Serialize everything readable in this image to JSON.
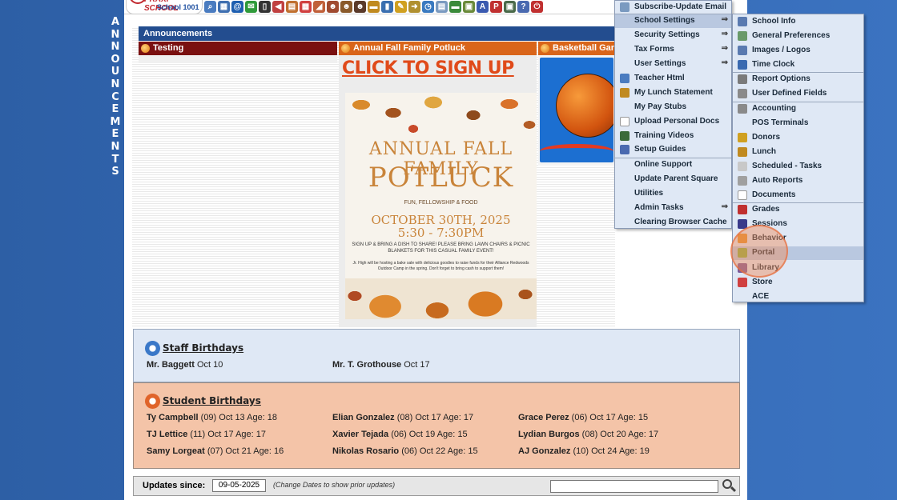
{
  "side_letters": [
    "A",
    "N",
    "N",
    "O",
    "U",
    "N",
    "C",
    "E",
    "M",
    "E",
    "N",
    "T",
    "S"
  ],
  "logo": {
    "brand": "PRAXI SCHOOL",
    "school": "School 1001"
  },
  "toolbar_icons": [
    {
      "name": "search-icon",
      "color": "#4a7cc0",
      "glyph": "⌕"
    },
    {
      "name": "calendar-grid-icon",
      "color": "#3f6fb0",
      "glyph": "▦"
    },
    {
      "name": "email-icon",
      "color": "#1f5fb0",
      "glyph": "@"
    },
    {
      "name": "chat-icon",
      "color": "#2f9a3a",
      "glyph": "✉"
    },
    {
      "name": "phone-icon",
      "color": "#333333",
      "glyph": "▯"
    },
    {
      "name": "megaphone-icon",
      "color": "#c04040",
      "glyph": "◀"
    },
    {
      "name": "report-icon",
      "color": "#c07030",
      "glyph": "▤"
    },
    {
      "name": "calendar-icon",
      "color": "#d04040",
      "glyph": "▦"
    },
    {
      "name": "announcement-icon",
      "color": "#c0603a",
      "glyph": "◢"
    },
    {
      "name": "user-icon",
      "color": "#a04a30",
      "glyph": "☻"
    },
    {
      "name": "teacher-icon",
      "color": "#8a5a2a",
      "glyph": "☻"
    },
    {
      "name": "group-icon",
      "color": "#5a3a2a",
      "glyph": "☻"
    },
    {
      "name": "ticket-icon",
      "color": "#c08a20",
      "glyph": "▬"
    },
    {
      "name": "book-icon",
      "color": "#3a6fb0",
      "glyph": "▮"
    },
    {
      "name": "pencil-icon",
      "color": "#d0a020",
      "glyph": "✎"
    },
    {
      "name": "forward-icon",
      "color": "#b09030",
      "glyph": "➜"
    },
    {
      "name": "clock-icon",
      "color": "#3a7ac0",
      "glyph": "◷"
    },
    {
      "name": "sheet-icon",
      "color": "#7a9ac0",
      "glyph": "▤"
    },
    {
      "name": "money-icon",
      "color": "#3a8a3a",
      "glyph": "▬"
    },
    {
      "name": "printer-icon",
      "color": "#6a8a3a",
      "glyph": "▣"
    },
    {
      "name": "api-icon",
      "color": "#3a5ab0",
      "glyph": "A"
    },
    {
      "name": "pdf-icon",
      "color": "#c03030",
      "glyph": "P"
    },
    {
      "name": "cash-icon",
      "color": "#4a6a4a",
      "glyph": "▣"
    },
    {
      "name": "help-icon",
      "color": "#4a6ab0",
      "glyph": "?"
    },
    {
      "name": "power-icon",
      "color": "#c03030",
      "glyph": "⏻"
    }
  ],
  "announcements": {
    "header": "Announcements",
    "columns": [
      {
        "title": "Testing"
      },
      {
        "title": "Annual Fall Family Potluck",
        "link": "CLICK TO SIGN UP"
      },
      {
        "title": "Basketball Game"
      }
    ],
    "flyer": {
      "title1": "ANNUAL FALL FAMILY",
      "title2": "POTLUCK",
      "tagline": "FUN, FELLOWSHIP & FOOD",
      "date1": "OCTOBER 30TH, 2025",
      "date2": "5:30 - 7:30PM",
      "note1": "SIGN UP & BRING A DISH TO SHARE! PLEASE BRING LAWN CHAIRS & PICNIC BLANKETS FOR THIS CASUAL FAMILY EVENT!",
      "note2": "Jr. High will be hosting a bake sale with delicious goodies to raise funds for their Alliance Redwoods Outdoor Camp in the spring. Don't forget to bring cash to support them!"
    }
  },
  "staff_birthdays": {
    "title": "Staff Birthdays",
    "entries": [
      {
        "name": "Mr. Baggett",
        "detail": "Oct 10"
      },
      {
        "name": "Mr. T. Grothouse",
        "detail": "Oct 17"
      }
    ]
  },
  "student_birthdays": {
    "title": "Student Birthdays",
    "entries": [
      {
        "name": "Ty Campbell",
        "detail": "(09) Oct 13 Age: 18"
      },
      {
        "name": "Elian Gonzalez",
        "detail": "(08) Oct 17 Age: 17"
      },
      {
        "name": "Grace Perez",
        "detail": "(06) Oct 17 Age: 15"
      },
      {
        "name": "TJ Lettice",
        "detail": "(11) Oct 17 Age: 17"
      },
      {
        "name": "Xavier Tejada",
        "detail": "(06) Oct 19 Age: 15"
      },
      {
        "name": "Lydian Burgos",
        "detail": "(08) Oct 20 Age: 17"
      },
      {
        "name": "Samy Lorgeat",
        "detail": "(07) Oct 21 Age: 16"
      },
      {
        "name": "Nikolas Rosario",
        "detail": "(06) Oct 22 Age: 15"
      },
      {
        "name": "AJ Gonzalez",
        "detail": "(10) Oct 24 Age: 19"
      }
    ]
  },
  "updates": {
    "label": "Updates since:",
    "date": "09-05-2025",
    "hint": "(Change Dates to show prior updates)",
    "search_value": ""
  },
  "menu1": {
    "items": [
      {
        "label": "Subscribe-Update Email",
        "icon": "email-icon",
        "icon_color": "#7a9ac0",
        "arrow": ""
      },
      {
        "label": "School Settings",
        "icon": "",
        "icon_color": "",
        "arrow": "⇒",
        "active": true
      },
      {
        "label": "Security Settings",
        "icon": "",
        "icon_color": "",
        "arrow": "⇒"
      },
      {
        "label": "Tax Forms",
        "icon": "",
        "icon_color": "",
        "arrow": "⇒"
      },
      {
        "label": "User Settings",
        "icon": "",
        "icon_color": "",
        "arrow": "⇒"
      },
      {
        "label": "Teacher Html",
        "icon": "html-icon",
        "icon_color": "#4a7cc0",
        "arrow": ""
      },
      {
        "label": "My Lunch Statement",
        "icon": "lunch-icon",
        "icon_color": "#c08a20",
        "arrow": ""
      },
      {
        "label": "My Pay Stubs",
        "icon": "",
        "icon_color": "",
        "arrow": ""
      },
      {
        "label": "Upload Personal Docs",
        "icon": "document-icon",
        "icon_color": "#ffffff",
        "arrow": ""
      },
      {
        "label": "Training Videos",
        "icon": "film-icon",
        "icon_color": "#3a6a3a",
        "arrow": ""
      },
      {
        "label": "Setup Guides",
        "icon": "help-icon",
        "icon_color": "#4a6ab0",
        "arrow": ""
      },
      {
        "label": "Online Support",
        "icon": "",
        "icon_color": "",
        "arrow": ""
      },
      {
        "label": "Update Parent Square",
        "icon": "",
        "icon_color": "",
        "arrow": ""
      },
      {
        "label": "Utilities",
        "icon": "",
        "icon_color": "",
        "arrow": ""
      },
      {
        "label": "Admin Tasks",
        "icon": "",
        "icon_color": "",
        "arrow": "⇒"
      },
      {
        "label": "Clearing Browser Cache",
        "icon": "",
        "icon_color": "",
        "arrow": ""
      }
    ]
  },
  "menu2": {
    "items": [
      {
        "label": "School Info",
        "icon": "person-icon",
        "icon_color": "#5a7ab0"
      },
      {
        "label": "General Preferences",
        "icon": "preferences-icon",
        "icon_color": "#6a9a6a"
      },
      {
        "label": "Images / Logos",
        "icon": "images-icon",
        "icon_color": "#5a7ab0"
      },
      {
        "label": "Time Clock",
        "icon": "clock-icon",
        "icon_color": "#3a6ab0"
      },
      {
        "label": "Report Options",
        "icon": "printer-icon",
        "icon_color": "#7a7a7a"
      },
      {
        "label": "User Defined Fields",
        "icon": "gear-icon",
        "icon_color": "#8a8a8a"
      },
      {
        "label": "Accounting",
        "icon": "gear-icon",
        "icon_color": "#8a8a8a"
      },
      {
        "label": "POS Terminals",
        "icon": "",
        "icon_color": ""
      },
      {
        "label": "Donors",
        "icon": "donor-icon",
        "icon_color": "#d0a020"
      },
      {
        "label": "Lunch",
        "icon": "lunch-icon",
        "icon_color": "#c08a20"
      },
      {
        "label": "Scheduled - Tasks",
        "icon": "task-icon",
        "icon_color": "#c8c8c8"
      },
      {
        "label": "Auto Reports",
        "icon": "report-icon",
        "icon_color": "#a0a0a0"
      },
      {
        "label": "Documents",
        "icon": "document-icon",
        "icon_color": "#ffffff"
      },
      {
        "label": "Grades",
        "icon": "grades-icon",
        "icon_color": "#c03030"
      },
      {
        "label": "Sessions",
        "icon": "sessions-icon",
        "icon_color": "#3a3a8a"
      },
      {
        "label": "Behavior",
        "icon": "behavior-icon",
        "icon_color": "#e09030"
      },
      {
        "label": "Portal",
        "icon": "portal-icon",
        "icon_color": "#8ab040",
        "active": true
      },
      {
        "label": "Library",
        "icon": "library-icon",
        "icon_color": "#7a5a9a"
      },
      {
        "label": "Store",
        "icon": "store-icon",
        "icon_color": "#d04040"
      },
      {
        "label": "ACE",
        "icon": "",
        "icon_color": ""
      }
    ]
  }
}
